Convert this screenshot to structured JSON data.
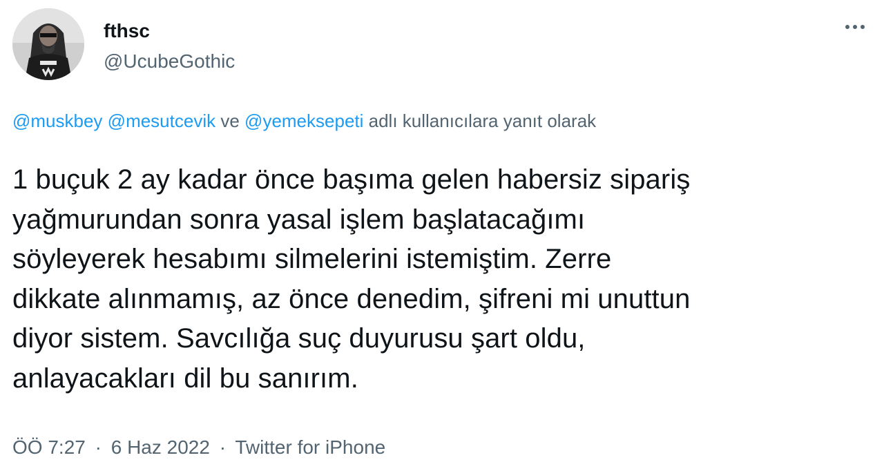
{
  "author": {
    "display_name": "fthsc",
    "handle": "@UcubeGothic"
  },
  "more_icon": "more-horizontal-icon",
  "reply_context": {
    "mentions": [
      "@muskbey",
      "@mesutcevik",
      "@yemeksepeti"
    ],
    "connector": "ve",
    "suffix": "adlı kullanıcılara yanıt olarak"
  },
  "tweet_lines": [
    "1 buçuk 2 ay kadar önce başıma gelen habersiz sipariş",
    "yağmurundan sonra yasal işlem başlatacağımı",
    "söyleyerek hesabımı silmelerini istemiştim. Zerre",
    "dikkate alınmamış, az önce denedim, şifreni mi unuttun",
    "diyor sistem. Savcılığa suç duyurusu şart oldu,",
    "anlayacakları dil bu sanırım."
  ],
  "meta": {
    "time": "ÖÖ 7:27",
    "date": "6 Haz 2022",
    "source": "Twitter for iPhone",
    "separator": "·"
  },
  "colors": {
    "link": "#1d9bf0",
    "secondary_text": "#536471",
    "primary_text": "#0f1419"
  }
}
